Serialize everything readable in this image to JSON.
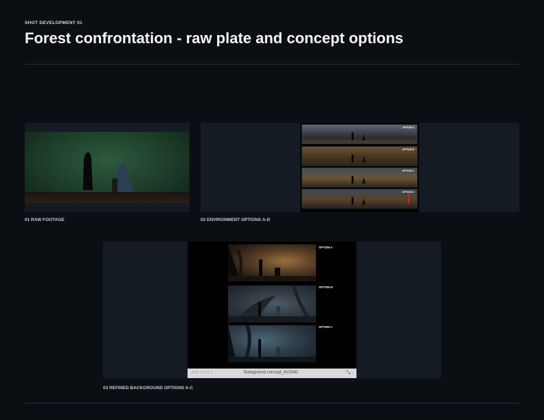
{
  "header": {
    "eyebrow": "SHOT DEVELOPMENT 01",
    "title": "Forest confrontation - raw plate and concept options"
  },
  "sections": [
    {
      "caption": "01 RAW FOOTAGE"
    },
    {
      "caption": "02 ENVIRONMENT OPTIONS A-D",
      "options": [
        "OPTION A",
        "OPTION B",
        "OPTION C",
        "OPTION D"
      ]
    },
    {
      "caption": "03 REFINED BACKGROUND OPTIONS A-C",
      "options": [
        "OPTION A",
        "OPTION B",
        "OPTION C"
      ],
      "viewer_bar": {
        "brand": "THE NUN 2",
        "filename": "Background concept_8V3340",
        "icon": "expand-icon"
      }
    }
  ],
  "colors": {
    "background": "#0b0e13",
    "panel": "#141b23",
    "rule": "#2a3038",
    "text": "#f4f5f7"
  }
}
